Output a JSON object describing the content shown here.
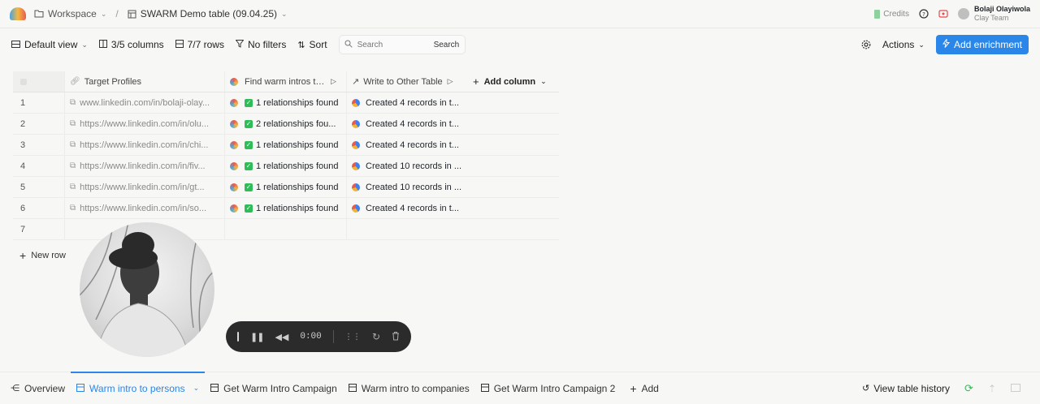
{
  "topbar": {
    "workspace": "Workspace",
    "table_name": "SWARM Demo table (09.04.25)",
    "credits": "Credits",
    "user_name": "Bolaji Olayiwola",
    "team": "Clay Team"
  },
  "toolbar": {
    "view": "Default view",
    "columns": "3/5 columns",
    "rows": "7/7 rows",
    "filters": "No filters",
    "sort": "Sort",
    "search_placeholder": "Search",
    "search_button": "Search",
    "actions": "Actions",
    "add_enrichment": "Add enrichment"
  },
  "table": {
    "headers": {
      "target": "Target Profiles",
      "find": "Find warm intros to p",
      "write": "Write to Other Table",
      "add_column": "Add column"
    },
    "rows": [
      {
        "num": "1",
        "url": "www.linkedin.com/in/bolaji-olay...",
        "rel": "1 relationships found",
        "write": "Created 4 records in t..."
      },
      {
        "num": "2",
        "url": "https://www.linkedin.com/in/olu...",
        "rel": "2 relationships fou...",
        "write": "Created 4 records in t..."
      },
      {
        "num": "3",
        "url": "https://www.linkedin.com/in/chi...",
        "rel": "1 relationships found",
        "write": "Created 4 records in t..."
      },
      {
        "num": "4",
        "url": "https://www.linkedin.com/in/fiv...",
        "rel": "1 relationships found",
        "write": "Created 10 records in ..."
      },
      {
        "num": "5",
        "url": "https://www.linkedin.com/in/gt...",
        "rel": "1 relationships found",
        "write": "Created 10 records in ..."
      },
      {
        "num": "6",
        "url": "https://www.linkedin.com/in/so...",
        "rel": "1 relationships found",
        "write": "Created 4 records in t..."
      },
      {
        "num": "7",
        "url": "",
        "rel": "",
        "write": ""
      }
    ],
    "new_row": "New row"
  },
  "recorder": {
    "time": "0:00"
  },
  "bottom": {
    "tabs": [
      "Overview",
      "Warm intro to persons",
      "Get Warm Intro Campaign",
      "Warm intro to companies",
      "Get Warm Intro Campaign 2"
    ],
    "add": "Add",
    "history": "View table history"
  },
  "colors": {
    "accent": "#2a86e8",
    "success": "#2ebd59"
  }
}
